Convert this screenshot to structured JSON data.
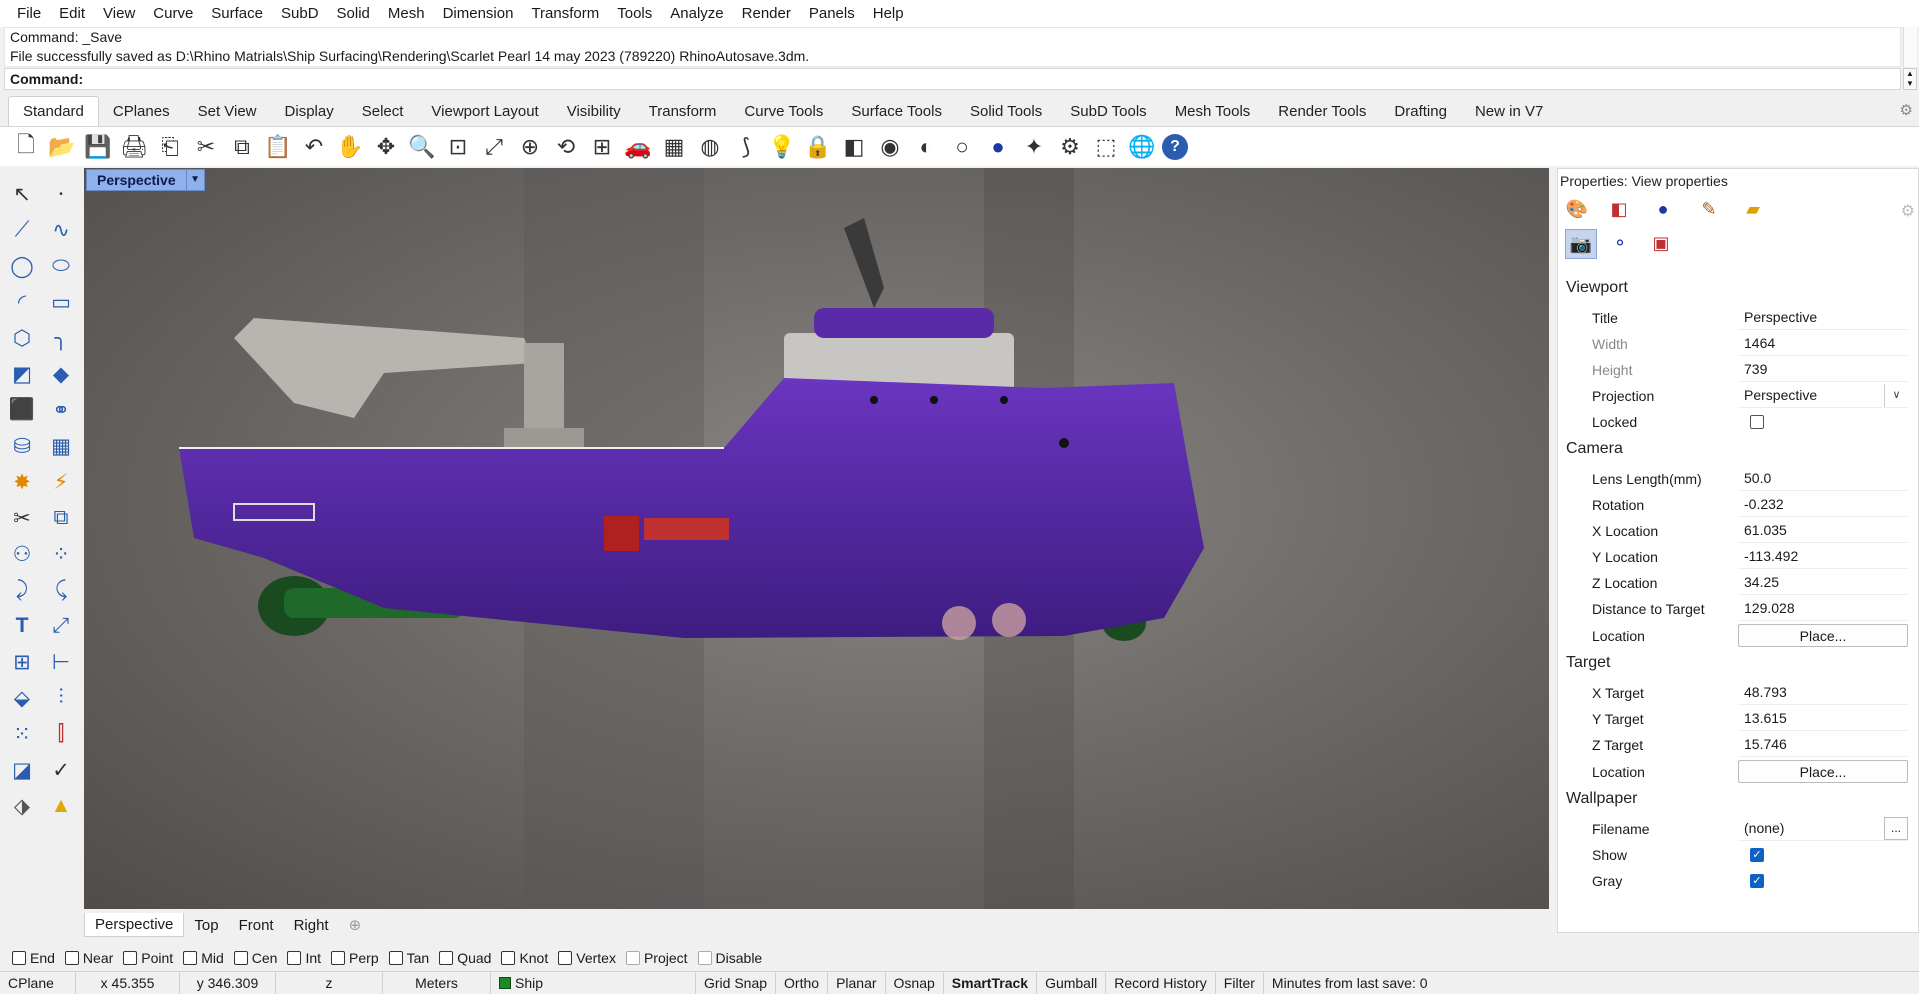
{
  "menu": [
    "File",
    "Edit",
    "View",
    "Curve",
    "Surface",
    "SubD",
    "Solid",
    "Mesh",
    "Dimension",
    "Transform",
    "Tools",
    "Analyze",
    "Render",
    "Panels",
    "Help"
  ],
  "command_history": {
    "line1": "Command: _Save",
    "line2": "File successfully saved as D:\\Rhino Matrials\\Ship Surfacing\\Rendering\\Scarlet Pearl 14 may 2023 (789220) RhinoAutosave.3dm."
  },
  "command_prompt": "Command:",
  "toolbar_tabs": [
    "Standard",
    "CPlanes",
    "Set View",
    "Display",
    "Select",
    "Viewport Layout",
    "Visibility",
    "Transform",
    "Curve Tools",
    "Surface Tools",
    "Solid Tools",
    "SubD Tools",
    "Mesh Tools",
    "Render Tools",
    "Drafting",
    "New in V7"
  ],
  "toolbar_icons": [
    "new-icon",
    "open-icon",
    "save-icon",
    "print-icon",
    "import-icon",
    "cut-icon",
    "copy-icon",
    "paste-icon",
    "undo-icon",
    "pan-icon",
    "rotate-view-icon",
    "zoom-icon",
    "zoom-window-icon",
    "zoom-extents-icon",
    "zoom-selected-icon",
    "rotate-icon",
    "four-view-icon",
    "car-icon",
    "grid-icon",
    "circle-icon",
    "sweep-icon",
    "bulb-icon",
    "lock-icon",
    "layer-icon",
    "color-wheel-icon",
    "sphere-grey-icon",
    "sphere-white-icon",
    "sphere-blue-icon",
    "light-icon",
    "gear-icon",
    "bounding-box-icon",
    "render-globe-icon",
    "help-icon"
  ],
  "viewport": {
    "title": "Perspective",
    "tabs": [
      "Perspective",
      "Top",
      "Front",
      "Right"
    ],
    "add_tab": "⊕"
  },
  "osnaps": [
    {
      "label": "End",
      "checked": false
    },
    {
      "label": "Near",
      "checked": false
    },
    {
      "label": "Point",
      "checked": false
    },
    {
      "label": "Mid",
      "checked": false
    },
    {
      "label": "Cen",
      "checked": false
    },
    {
      "label": "Int",
      "checked": false
    },
    {
      "label": "Perp",
      "checked": false
    },
    {
      "label": "Tan",
      "checked": false
    },
    {
      "label": "Quad",
      "checked": false
    },
    {
      "label": "Knot",
      "checked": false
    },
    {
      "label": "Vertex",
      "checked": false
    },
    {
      "label": "Project",
      "checked": false
    },
    {
      "label": "Disable",
      "checked": false
    }
  ],
  "status": {
    "cplane": "CPlane",
    "x": "x 45.355",
    "y": "y 346.309",
    "z": "z",
    "units": "Meters",
    "layer": "Ship",
    "layer_color": "#1a8a2a",
    "grid_snap": "Grid Snap",
    "ortho": "Ortho",
    "planar": "Planar",
    "osnap": "Osnap",
    "smarttrack": "SmartTrack",
    "gumball": "Gumball",
    "record_history": "Record History",
    "filter": "Filter",
    "last_save": "Minutes from last save: 0"
  },
  "properties": {
    "title": "Properties: View properties",
    "viewport_section": "Viewport",
    "title_label": "Title",
    "title_value": "Perspective",
    "width_label": "Width",
    "width_value": "1464",
    "height_label": "Height",
    "height_value": "739",
    "projection_label": "Projection",
    "projection_value": "Perspective",
    "locked_label": "Locked",
    "camera_section": "Camera",
    "lens_label": "Lens Length(mm)",
    "lens_value": "50.0",
    "rotation_label": "Rotation",
    "rotation_value": "-0.232",
    "xloc_label": "X Location",
    "xloc_value": "61.035",
    "yloc_label": "Y Location",
    "yloc_value": "-113.492",
    "zloc_label": "Z Location",
    "zloc_value": "34.25",
    "dist_label": "Distance to Target",
    "dist_value": "129.028",
    "location_label": "Location",
    "place_button": "Place...",
    "target_section": "Target",
    "xt_label": "X Target",
    "xt_value": "48.793",
    "yt_label": "Y Target",
    "yt_value": "13.615",
    "zt_label": "Z Target",
    "zt_value": "15.746",
    "tlocation_label": "Location",
    "wallpaper_section": "Wallpaper",
    "filename_label": "Filename",
    "filename_value": "(none)",
    "show_label": "Show",
    "gray_label": "Gray",
    "ellipsis": "...",
    "locked": false,
    "show": true,
    "gray": true
  },
  "accent_color": "#0f62c5",
  "hull_color": "#5b2aa8"
}
